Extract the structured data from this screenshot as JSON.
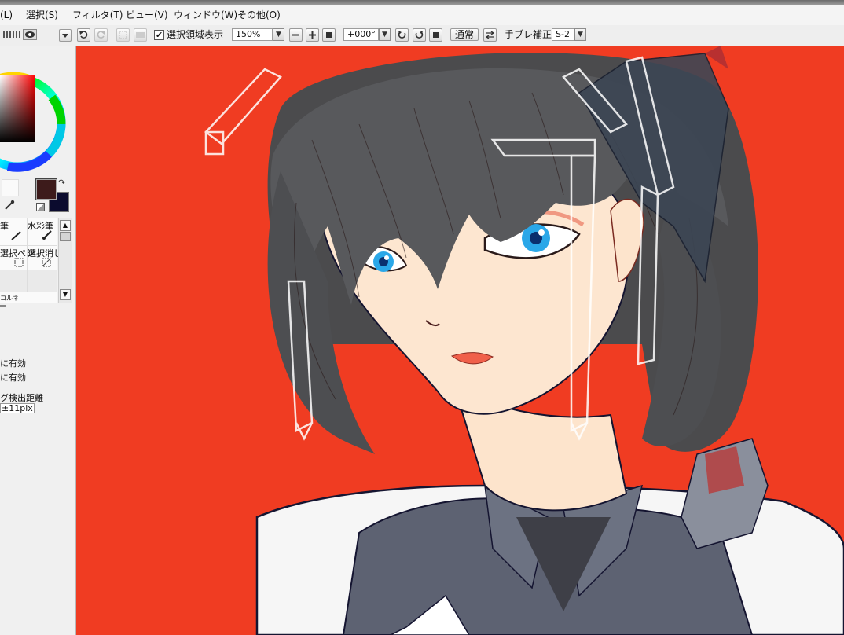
{
  "menu": {
    "items": [
      {
        "label": "(L)"
      },
      {
        "label": "選択(S)"
      },
      {
        "label": "フィルタ(T)"
      },
      {
        "label": "ビュー(V)"
      },
      {
        "label": "ウィンドウ(W)"
      },
      {
        "label": "その他(O)"
      }
    ]
  },
  "toolbar": {
    "show_selection_label": "選択領域表示",
    "show_selection_checked": true,
    "zoom_value": "150%",
    "rotation_value": "+000°",
    "blend_label": "通常",
    "stabilizer_label": "手ブレ補正",
    "stabilizer_value": "S-2"
  },
  "left_panel": {
    "primary_color": "#3d1b1b",
    "secondary_color": "#0b0b2e",
    "brush_cells": [
      "筆",
      "水彩筆",
      "選択ペン",
      "選択消し",
      "コルネ"
    ],
    "option_1": "に有効",
    "option_2": "に有効",
    "gap_label": "グ検出距離",
    "gap_value": "±11pix"
  },
  "canvas": {
    "background_color": "#f03c22",
    "subject": "anime-girl-portrait"
  }
}
